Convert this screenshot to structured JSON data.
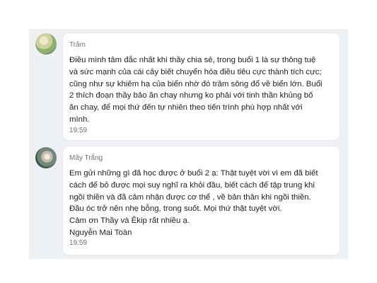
{
  "messages": [
    {
      "sender": "Trâm",
      "lines": [
        "Điều mình tâm đắc nhất khi thầy chia sẻ, trong buổi 1 là sự thông tuệ",
        "và sức mạnh của cái cây biết chuyển hóa điều tiêu cực thành tích cực;",
        "cũng như sự khiêm hạ của biển nhờ đó trăm sông đổ về biển lớn. Buổi",
        "2 thích đoạn thầy bảo ăn chay nhưng ko phải với tinh thần khủng bố",
        "ăn chay, để mọi thứ đến tự nhiên theo tiến trình phù hợp nhất với",
        "mình."
      ],
      "time": "19:59"
    },
    {
      "sender": "Mây Trắng",
      "lines": [
        "Em gửi những gì đã học được ở buổi 2 ạ: Thật tuyệt vời vì em đã biết",
        "cách để bỏ được mọi suy nghĩ ra khỏi đầu, biết cách để tập trung khi",
        "ngồi thiền và đã cảm nhận được cơ thể , về bản thân khi ngồi thiền.",
        "Đầu óc trở nên nhẹ bỗng, trong suốt. Mọi thứ thật tuyệt vời.",
        "Cảm ơn Thầy và Êkip rất nhiều ạ.",
        "Nguyễn Mai Toàn"
      ],
      "time": "19:59"
    }
  ]
}
